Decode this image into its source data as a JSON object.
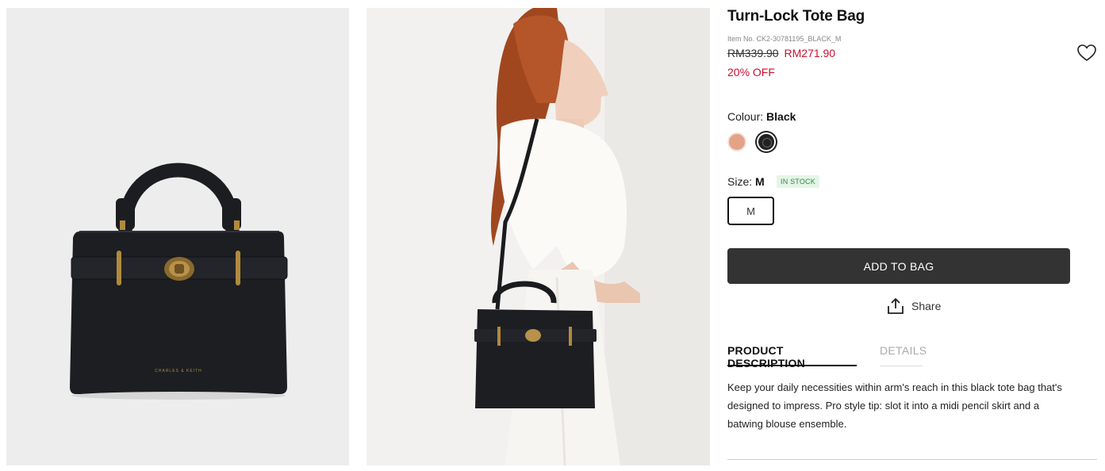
{
  "product": {
    "title": "Turn-Lock Tote Bag",
    "item_no": "Item No. CK2-30781195_BLACK_M",
    "price_original": "RM339.90",
    "price_sale": "RM271.90",
    "discount": "20% OFF"
  },
  "colour": {
    "label": "Colour:",
    "selected": "Black",
    "swatches": [
      {
        "name": "peach",
        "hex": "#e3a387"
      },
      {
        "name": "black",
        "hex": "#222222"
      }
    ]
  },
  "size": {
    "label": "Size:",
    "selected": "M",
    "stock_status": "IN STOCK",
    "options": [
      "M"
    ]
  },
  "actions": {
    "add_to_bag": "ADD TO BAG",
    "share": "Share"
  },
  "tabs": {
    "product_description": "PRODUCT DESCRIPTION",
    "details": "DETAILS"
  },
  "description": "Keep your daily necessities within arm's reach in this black tote bag that's designed to impress. Pro style tip: slot it into a midi pencil skirt and a batwing blouse ensemble.",
  "icons": {
    "wishlist": "heart-icon",
    "share": "share-icon"
  },
  "colors": {
    "sale": "#c8102e",
    "button": "#333333",
    "stock_text": "#2f8a3e",
    "stock_bg": "#e4f5e7"
  }
}
